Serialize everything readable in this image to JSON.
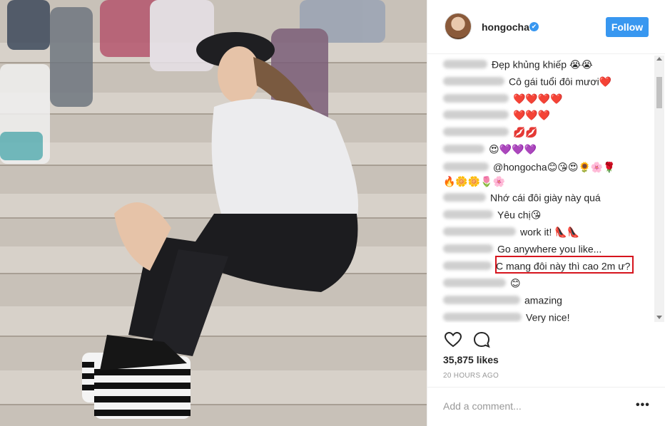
{
  "post": {
    "username": "hongocha",
    "verified_badge": "✔",
    "follow_label": "Follow",
    "likes": "35,875 likes",
    "time_ago": "20 HOURS AGO",
    "comment_placeholder": "Add a comment...",
    "more_glyph": "•••"
  },
  "comments": [
    {
      "text": "Đẹp khủng khiếp 😭😭"
    },
    {
      "text": "Cô gái tuổi đôi mươi❤️"
    },
    {
      "text": "❤️❤️❤️❤️"
    },
    {
      "text": "❤️❤️❤️"
    },
    {
      "text": "💋💋"
    },
    {
      "text": "😍💜💜💜"
    },
    {
      "text": "@hongocha😊😘😍🌻🌸🌹"
    },
    {
      "text": "🔥🌼🌼🌷🌸"
    },
    {
      "text": "Nhớ cái đôi giày này quá"
    },
    {
      "text": "Yêu chị😘"
    },
    {
      "text": "work it! 👠👠"
    },
    {
      "text": "Go anywhere you like..."
    },
    {
      "text": "C mang đôi này thì cao 2m ư?"
    },
    {
      "text": "😊"
    },
    {
      "text": "amazing"
    },
    {
      "text": "Very nice!"
    }
  ],
  "icons": {
    "like": "heart-icon",
    "comment": "comment-icon",
    "verified": "verified-badge-icon",
    "more": "more-options-icon"
  },
  "colors": {
    "accent": "#3897f0",
    "highlight_box": "#d6141d",
    "text": "#262626",
    "muted": "#999999"
  }
}
